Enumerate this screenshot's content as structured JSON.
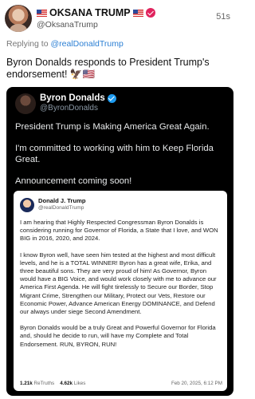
{
  "author": {
    "name": "🇺🇸 OKSANA TRUMP 🇺🇸",
    "name_text": "OKSANA TRUMP",
    "handle": "@OksanaTrump",
    "time": "51s"
  },
  "reply": {
    "prefix": "Replying to ",
    "target": "@realDonaldTrump"
  },
  "post_text": "Byron Donalds responds to President Trump's endorsement! 🦅🇺🇸",
  "embedded": {
    "name": "Byron Donalds",
    "handle": "@ByronDonalds",
    "paragraphs": [
      "President Trump is Making America Great Again.",
      "I'm committed to working with him to Keep Florida Great.",
      "Announcement coming soon!"
    ],
    "quoted": {
      "name": "Donald J. Trump",
      "handle": "@realDonaldTrump",
      "paragraphs": [
        "I am hearing that Highly Respected Congressman Byron Donalds is considering running for Governor of Florida, a State that I love, and WON BIG in 2016, 2020, and 2024.",
        "I know Byron well, have seen him tested at the highest and most difficult levels, and he is a TOTAL WINNER! Byron has a great wife, Erika, and three beautiful sons. They are very proud of him! As Governor, Byron would have a BIG Voice, and would work closely with me to advance our America First Agenda. He will fight tirelessly to Secure our Border, Stop Migrant Crime, Strengthen our Military, Protect our Vets, Restore our Economic Power, Advance American Energy DOMINANCE, and Defend our always under siege Second Amendment.",
        "Byron Donalds would be a truly Great and Powerful Governor for Florida and, should he decide to run, will have my Complete and Total Endorsement. RUN, BYRON, RUN!"
      ],
      "retruths_count": "1.21k",
      "retruths_label": "ReTruths",
      "likes_count": "4.62k",
      "likes_label": "Likes",
      "date": "Feb 20, 2025, 6:12 PM"
    }
  },
  "colors": {
    "verified_pink": "#e0245e",
    "link_blue": "#2b7fd4",
    "card_black": "#000000",
    "x_blue_check": "#1d9bf0"
  }
}
